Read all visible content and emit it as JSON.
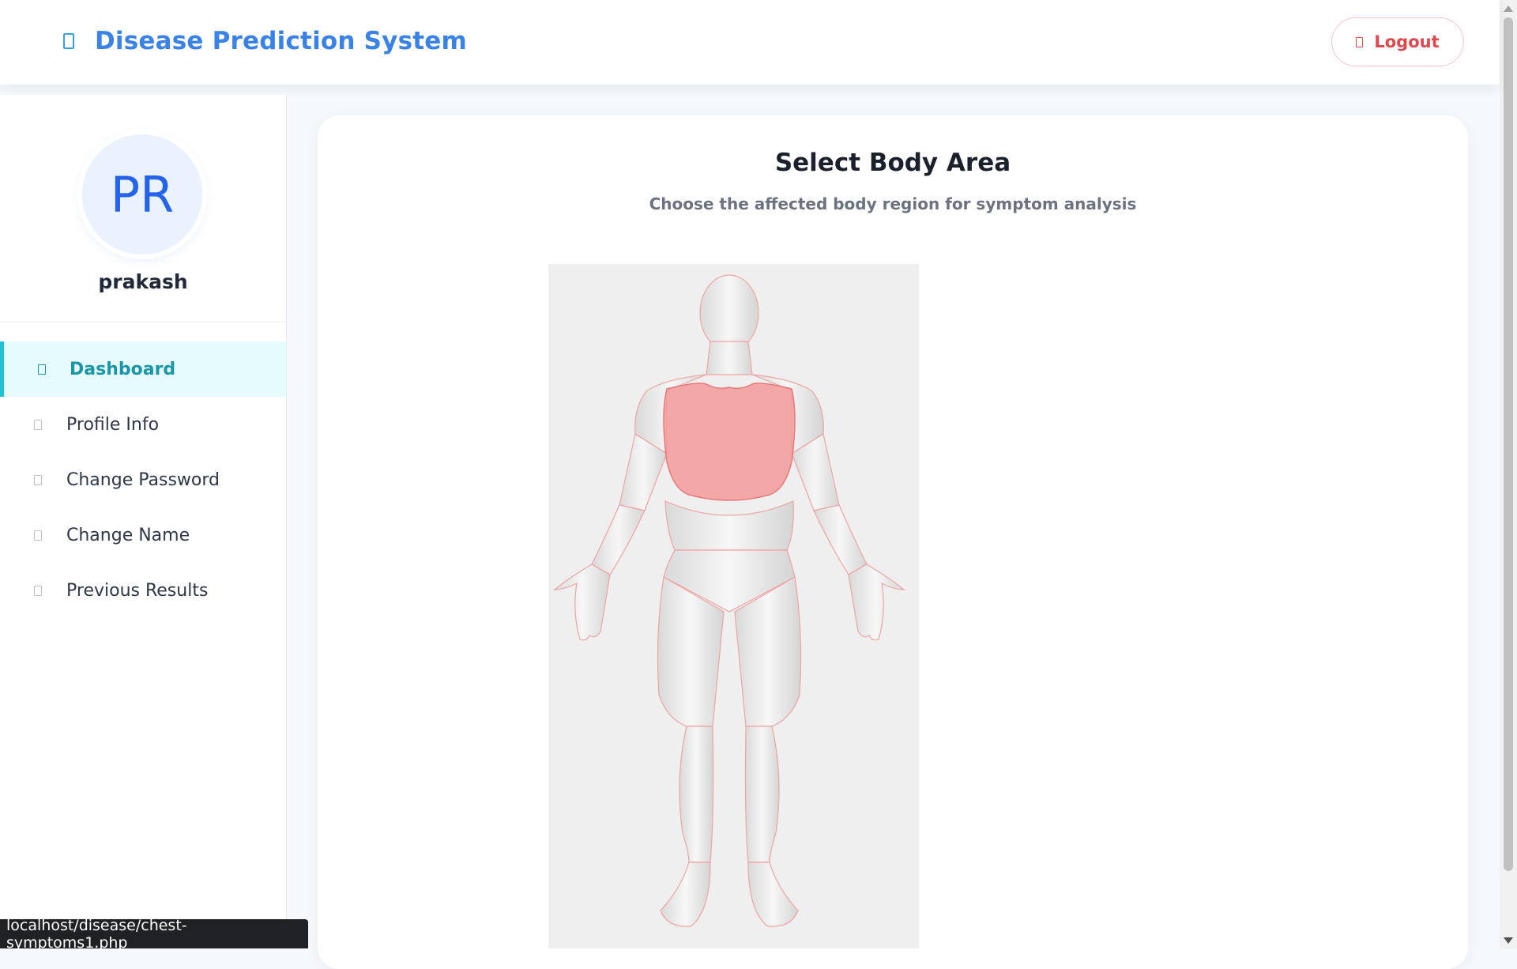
{
  "header": {
    "brand_icon": "hospital-icon",
    "title": "Disease Prediction System",
    "logout_icon": "logout-icon",
    "logout_label": "Logout"
  },
  "sidebar": {
    "avatar_initials": "PR",
    "username": "prakash",
    "items": [
      {
        "label": "Dashboard",
        "icon": "home-icon",
        "active": true
      },
      {
        "label": "Profile Info",
        "icon": "user-icon",
        "active": false
      },
      {
        "label": "Change Password",
        "icon": "lock-icon",
        "active": false
      },
      {
        "label": "Change Name",
        "icon": "edit-icon",
        "active": false
      },
      {
        "label": "Previous Results",
        "icon": "history-icon",
        "active": false
      }
    ]
  },
  "main": {
    "title": "Select Body Area",
    "subtitle": "Choose the affected body region for symptom analysis",
    "highlighted_region": "chest"
  },
  "statusbar": {
    "url": "localhost/disease/chest-symptoms1.php"
  },
  "colors": {
    "brand": "#3b82e6",
    "active_nav": "#1a96a8",
    "logout": "#e0484e",
    "highlight": "#f28b8b"
  }
}
